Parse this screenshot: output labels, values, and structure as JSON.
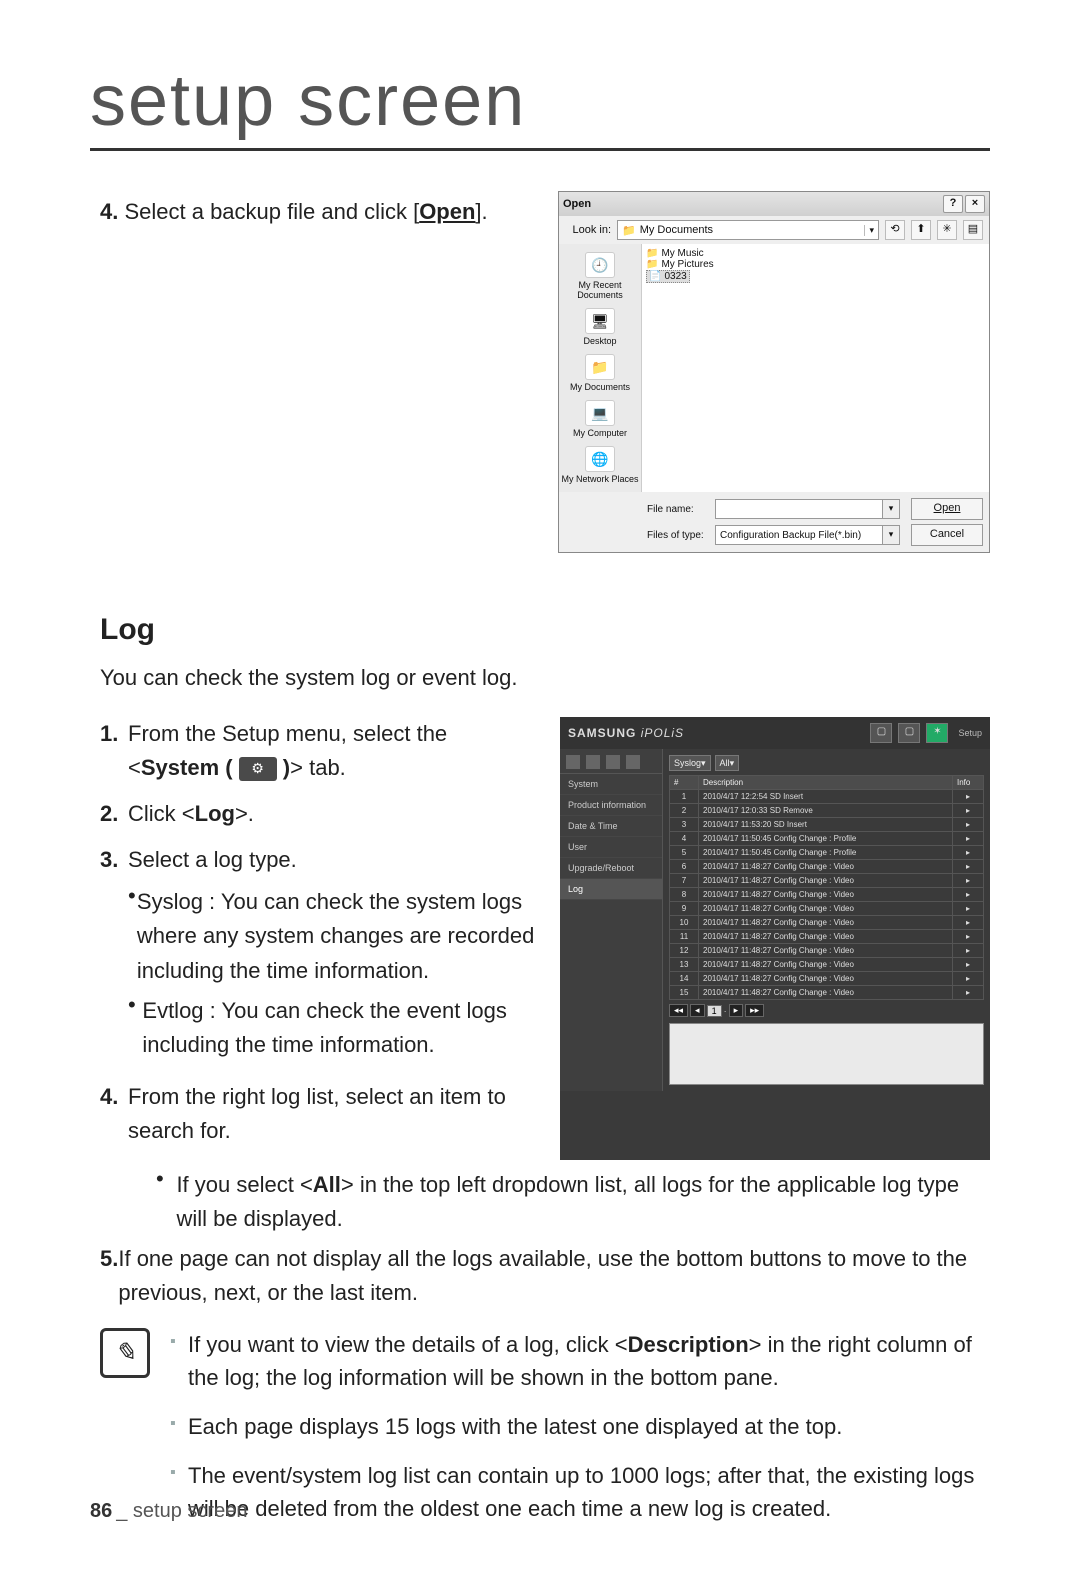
{
  "title": "setup screen",
  "step4_prefix": "4.",
  "step4_text_a": " Select a backup file and click [",
  "step4_open_label": "Open",
  "step4_text_b": "].",
  "open_dialog": {
    "title": "Open",
    "help": "?",
    "close": "×",
    "lookin_label": "Look in:",
    "lookin_value": "My Documents",
    "dropdown_glyph": "▾",
    "toolbar": {
      "back": "⟲",
      "up": "⬆",
      "new": "✳",
      "view": "▤"
    },
    "places": [
      {
        "icon": "🕘",
        "label": "My Recent Documents"
      },
      {
        "icon": "🖥",
        "label": "Desktop"
      },
      {
        "icon": "📁",
        "label": "My Documents"
      },
      {
        "icon": "💻",
        "label": "My Computer"
      },
      {
        "icon": "🌐",
        "label": "My Network Places"
      }
    ],
    "files": [
      {
        "icon": "📁",
        "name": "My Music"
      },
      {
        "icon": "📁",
        "name": "My Pictures"
      },
      {
        "icon": "📄",
        "name": "0323",
        "selected": true
      }
    ],
    "filename_label": "File name:",
    "filename_value": "",
    "filetype_label": "Files of type:",
    "filetype_value": "Configuration Backup File(*.bin)",
    "open_btn": "Open",
    "cancel_btn": "Cancel"
  },
  "log_heading": "Log",
  "log_intro": "You can check the system log or event log.",
  "log_step1_num": "1.",
  "log_step1_a": "From the Setup menu, select the <",
  "log_step1_b": "System ( ",
  "log_step1_c": " )",
  "log_step1_d": "> tab.",
  "sys_icon_glyph": "⚙",
  "log_step2_num": "2.",
  "log_step2_a": "Click <",
  "log_step2_b": "Log",
  "log_step2_c": ">.",
  "log_step3_num": "3.",
  "log_step3_text": "Select a log type.",
  "log_step3_b1": "Syslog : You can check the system logs where any system changes are recorded including the time information.",
  "log_step3_b2": "Evtlog : You can check the event logs including the time information.",
  "log_step4_num": "4.",
  "log_step4_text": "From the right log list, select an item to search for.",
  "log_step4_b1a": "If you select <",
  "log_step4_b1b": "All",
  "log_step4_b1c": "> in the top left dropdown list, all logs for the applicable log type will be displayed.",
  "log_step5_num": "5.",
  "log_step5_text": "If one page can not display all the logs available, use the bottom buttons to move to the previous, next, or the last item.",
  "note_icon": "✎",
  "note1_a": "If you want to view the details of a log, click <",
  "note1_b": "Description",
  "note1_c": "> in the right column of the log; the log information will be shown in the bottom pane.",
  "note2": "Each page displays 15 logs with the latest one displayed at the top.",
  "note3": "The event/system log list can contain up to 1000 logs; after that, the existing logs will be deleted from the oldest one each time a new log is created.",
  "ipolis": {
    "brand_a": "SAMSUNG",
    "brand_b": "iPOLiS",
    "setup_label": "Setup",
    "side_icons_count": 4,
    "sidebar_items": [
      "System",
      "Product information",
      "Date & Time",
      "User",
      "Upgrade/Reboot",
      "Log"
    ],
    "filter_label": "Syslog",
    "filter_value": "All",
    "columns": [
      "#",
      "Description",
      "Info"
    ],
    "rows": [
      {
        "n": "1",
        "d": "2010/4/17 12:2:54 SD Insert"
      },
      {
        "n": "2",
        "d": "2010/4/17 12:0:33 SD Remove"
      },
      {
        "n": "3",
        "d": "2010/4/17 11:53:20 SD Insert"
      },
      {
        "n": "4",
        "d": "2010/4/17 11:50:45 Config Change : Profile"
      },
      {
        "n": "5",
        "d": "2010/4/17 11:50:45 Config Change : Profile"
      },
      {
        "n": "6",
        "d": "2010/4/17 11:48:27 Config Change : Video"
      },
      {
        "n": "7",
        "d": "2010/4/17 11:48:27 Config Change : Video"
      },
      {
        "n": "8",
        "d": "2010/4/17 11:48:27 Config Change : Video"
      },
      {
        "n": "9",
        "d": "2010/4/17 11:48:27 Config Change : Video"
      },
      {
        "n": "10",
        "d": "2010/4/17 11:48:27 Config Change : Video"
      },
      {
        "n": "11",
        "d": "2010/4/17 11:48:27 Config Change : Video"
      },
      {
        "n": "12",
        "d": "2010/4/17 11:48:27 Config Change : Video"
      },
      {
        "n": "13",
        "d": "2010/4/17 11:48:27 Config Change : Video"
      },
      {
        "n": "14",
        "d": "2010/4/17 11:48:27 Config Change : Video"
      },
      {
        "n": "15",
        "d": "2010/4/17 11:48:27 Config Change : Video"
      }
    ],
    "info_glyph": "▸",
    "pager": {
      "first": "◂◂",
      "prev": "◂",
      "current": "1",
      "sep": "·",
      "next": "▸",
      "last": "▸▸"
    }
  },
  "footer_page": "86",
  "footer_sep": "_",
  "footer_text": " setup screen"
}
